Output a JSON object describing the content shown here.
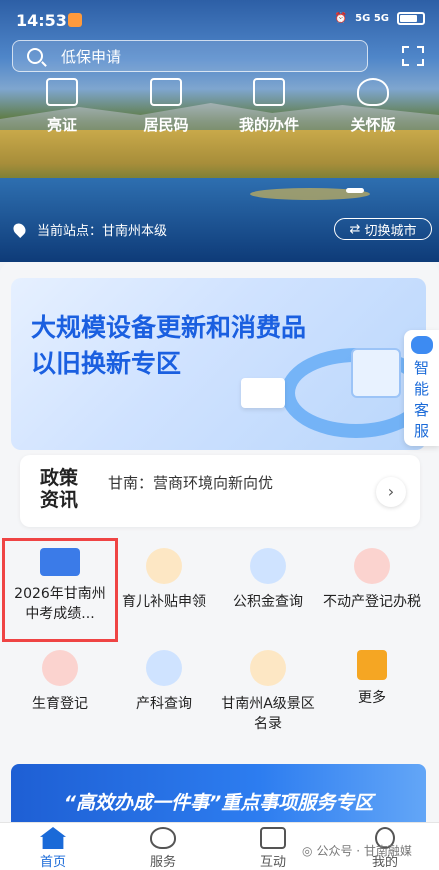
{
  "status_bar": {
    "time": "14:53",
    "network": "5G 5G"
  },
  "search": {
    "placeholder": "低保申请"
  },
  "quick_actions": [
    {
      "label": "亮证",
      "icon": "id-card-icon"
    },
    {
      "label": "居民码",
      "icon": "qr-code-icon"
    },
    {
      "label": "我的办件",
      "icon": "document-edit-icon"
    },
    {
      "label": "关怀版",
      "icon": "heart-icon"
    }
  ],
  "location": {
    "station": "当前站点：甘南州本级",
    "switch_label": "切换城市"
  },
  "banner": {
    "line1": "大规模设备更新和消费品",
    "line2": "以旧换新专区"
  },
  "customer_service": {
    "label": "智能客服"
  },
  "policy": {
    "label": "政策资讯",
    "headline": "甘南：营商环境向新向优"
  },
  "services": [
    {
      "label": "2026年甘南州中考成绩...",
      "icon": "exam-icon",
      "color": "#3b7be8"
    },
    {
      "label": "育儿补贴申领",
      "icon": "building-icon",
      "color": "#f5a623"
    },
    {
      "label": "公积金查询",
      "icon": "fund-house-icon",
      "color": "#3b8ef0"
    },
    {
      "label": "不动产登记办税",
      "icon": "house-tax-icon",
      "color": "#e8473b"
    },
    {
      "label": "生育登记",
      "icon": "birth-register-icon",
      "color": "#e8473b"
    },
    {
      "label": "产科查询",
      "icon": "maternity-icon",
      "color": "#3b8ef0"
    },
    {
      "label": "甘南州A级景区名录",
      "icon": "scenic-icon",
      "color": "#f5a623"
    },
    {
      "label": "更多",
      "icon": "more-grid-icon",
      "color": "#f5a623"
    }
  ],
  "banner2": {
    "title": "“高效办成一件事”重点事项服务专区"
  },
  "tabs": [
    {
      "label": "首页",
      "icon": "home-icon",
      "active": true
    },
    {
      "label": "服务",
      "icon": "service-heart-icon",
      "active": false
    },
    {
      "label": "互动",
      "icon": "interact-icon",
      "active": false
    },
    {
      "label": "我的",
      "icon": "profile-icon",
      "active": false
    }
  ],
  "watermark": "公众号 · 甘南融媒"
}
